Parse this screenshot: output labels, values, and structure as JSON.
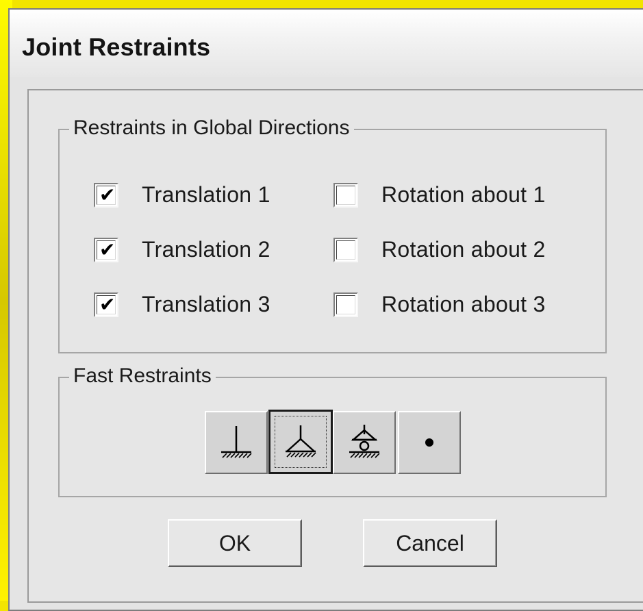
{
  "window": {
    "title": "Joint Restraints"
  },
  "global_group": {
    "legend": "Restraints in Global Directions",
    "translations": [
      {
        "label": "Translation  1",
        "checked": true
      },
      {
        "label": "Translation  2",
        "checked": true
      },
      {
        "label": "Translation  3",
        "checked": true
      }
    ],
    "rotations": [
      {
        "label": "Rotation about  1",
        "checked": false
      },
      {
        "label": "Rotation about  2",
        "checked": false
      },
      {
        "label": "Rotation about  3",
        "checked": false
      }
    ]
  },
  "fast_group": {
    "legend": "Fast Restraints",
    "buttons": [
      {
        "icon": "fixed-support-icon"
      },
      {
        "icon": "pinned-support-icon",
        "selected": true
      },
      {
        "icon": "roller-support-icon"
      },
      {
        "icon": "free-joint-icon"
      }
    ]
  },
  "buttons": {
    "ok": "OK",
    "cancel": "Cancel"
  },
  "colors": {
    "background": "#f2e400",
    "dialog": "#e4e4e4"
  }
}
